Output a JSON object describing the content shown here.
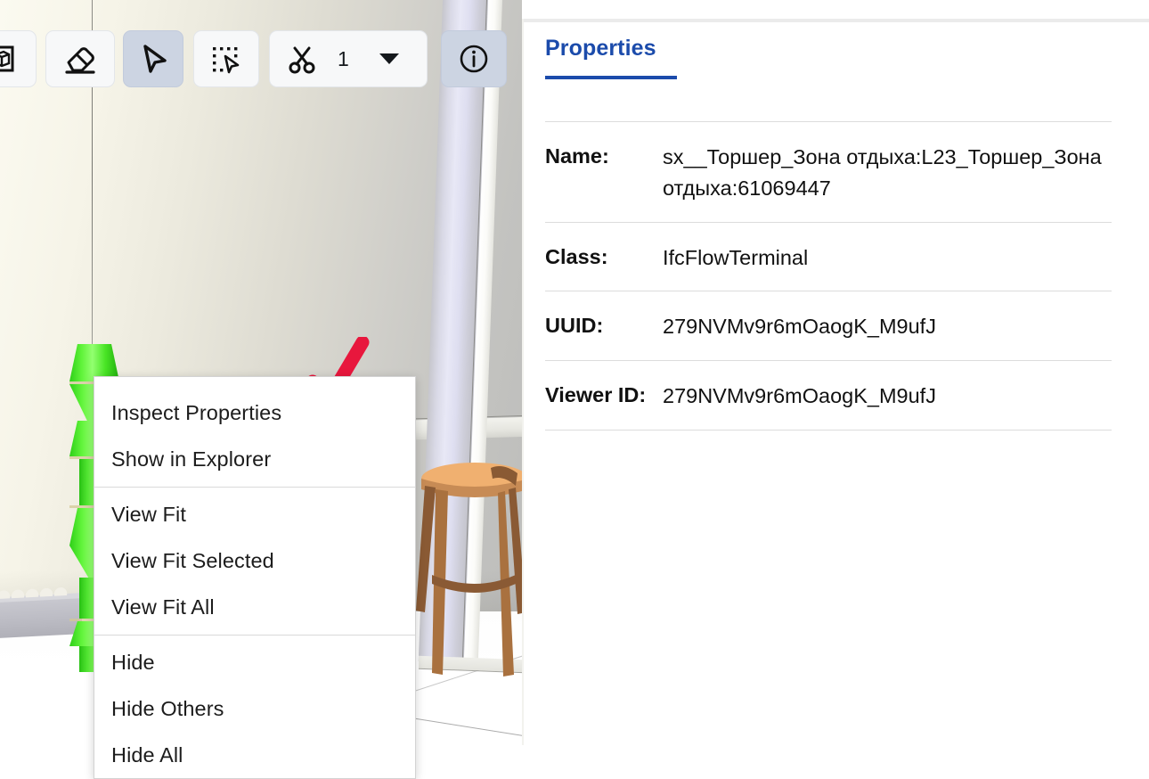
{
  "toolbar": {
    "buttons": [
      {
        "name": "box-select-tool",
        "icon": "cube-frame-icon",
        "active": false
      },
      {
        "name": "eraser-tool",
        "icon": "eraser-icon",
        "active": false
      },
      {
        "name": "pointer-select-tool",
        "icon": "cursor-arrow-icon",
        "active": true
      },
      {
        "name": "marquee-select-tool",
        "icon": "marquee-select-icon",
        "active": false
      },
      {
        "name": "section-cut-tool",
        "icon": "scissors-icon",
        "active": false
      },
      {
        "name": "info-tool",
        "icon": "info-circle-icon",
        "active": true
      }
    ],
    "cut_count": "1",
    "cut_dropdown_icon": "chevron-down-icon"
  },
  "context_menu": {
    "groups": [
      [
        "Inspect Properties",
        "Show in Explorer"
      ],
      [
        "View Fit",
        "View Fit Selected",
        "View Fit All"
      ],
      [
        "Hide",
        "Hide Others",
        "Hide All"
      ]
    ]
  },
  "annotation": {
    "icon": "red-checkmark-icon",
    "color": "#e8173d"
  },
  "panel": {
    "tabs": [
      {
        "label": "Properties",
        "active": true
      }
    ],
    "accent_color": "#1b4bab",
    "rows": [
      {
        "key": "Name:",
        "value": "sx__Торшер_Зона отдыха:L23_Торшер_Зона отдыха:61069447"
      },
      {
        "key": "Class:",
        "value": "IfcFlowTerminal"
      },
      {
        "key": "UUID:",
        "value": "279NVMv9r6mOaogK_M9ufJ"
      },
      {
        "key": "Viewer ID:",
        "value": "279NVMv9r6mOaogK_M9ufJ"
      }
    ]
  },
  "viewport": {
    "selection_color": "#4ae322",
    "selected_object": "floor-lamp-model",
    "scene_objects": [
      "wall",
      "column",
      "bar-stool",
      "floor",
      "baseboard",
      "hanging-cable"
    ]
  }
}
